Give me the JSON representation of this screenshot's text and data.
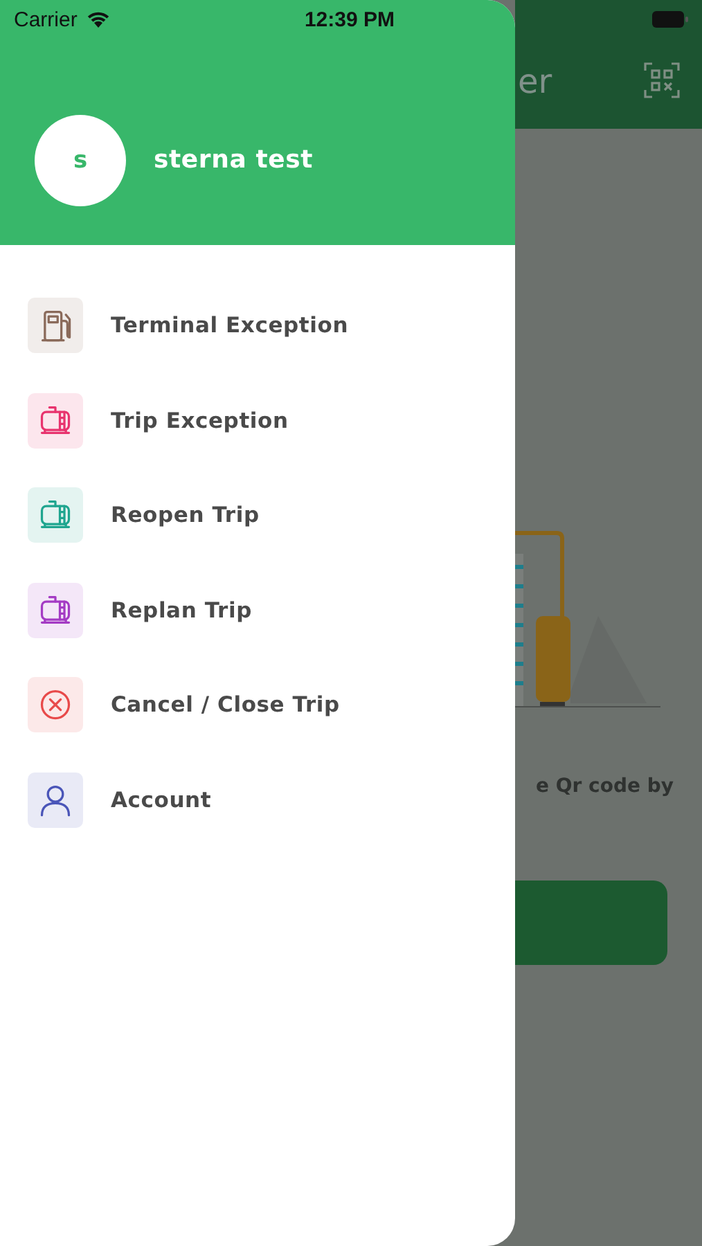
{
  "status_bar": {
    "carrier": "Carrier",
    "time": "12:39 PM"
  },
  "drawer": {
    "user": {
      "initial": "s",
      "name": "sterna test"
    },
    "items": [
      {
        "label": "Terminal Exception",
        "kind": "fuel",
        "color": "#8a6a5a"
      },
      {
        "label": "Trip Exception",
        "kind": "tank",
        "color": "#e8336e"
      },
      {
        "label": "Reopen Trip",
        "kind": "tank",
        "color": "#1ea58f"
      },
      {
        "label": "Replan Trip",
        "kind": "tank",
        "color": "#a43bc4"
      },
      {
        "label": "Cancel / Close Trip",
        "kind": "cancel",
        "color": "#e84a4a"
      },
      {
        "label": "Account",
        "kind": "account",
        "color": "#4a55b8"
      }
    ]
  },
  "background_screen": {
    "title": "er",
    "message": "e Qr code by"
  }
}
